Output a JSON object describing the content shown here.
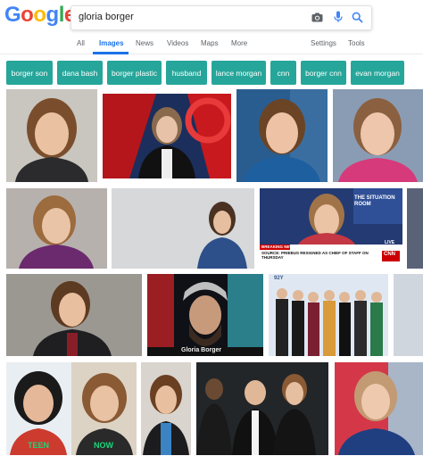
{
  "logo": {
    "letters": [
      "G",
      "o",
      "o",
      "g",
      "l",
      "e"
    ],
    "colors": [
      "#4285F4",
      "#EA4335",
      "#FBBC05",
      "#4285F4",
      "#34A853",
      "#EA4335"
    ]
  },
  "search": {
    "query": "gloria borger",
    "icons": [
      "camera-icon",
      "microphone-icon",
      "search-icon"
    ]
  },
  "tabs": {
    "all": "All",
    "images": "Images",
    "news": "News",
    "videos": "Videos",
    "maps": "Maps",
    "more": "More",
    "settings": "Settings",
    "tools": "Tools"
  },
  "chips": [
    "borger son",
    "dana bash",
    "borger plastic",
    "husband",
    "lance morgan",
    "cnn",
    "borger cnn",
    "evan morgan"
  ],
  "colors": {
    "chip": "#26a69a",
    "accent": "#1a73e8"
  },
  "thumbnails": {
    "t6_breaking": "BREAKING NEWS",
    "t6_headline": "SOURCE: PRIEBUS RESIGNED AS CHIEF OF STAFF ON THURSDAY",
    "t6_live": "LIVE",
    "t6_network": "CNN",
    "t6_banner": "THE SITUATION ROOM",
    "t9_caption": "Gloria Borger",
    "t10_logo": "92Y",
    "t11_left": "TEEN",
    "t11_right": "NOW"
  }
}
